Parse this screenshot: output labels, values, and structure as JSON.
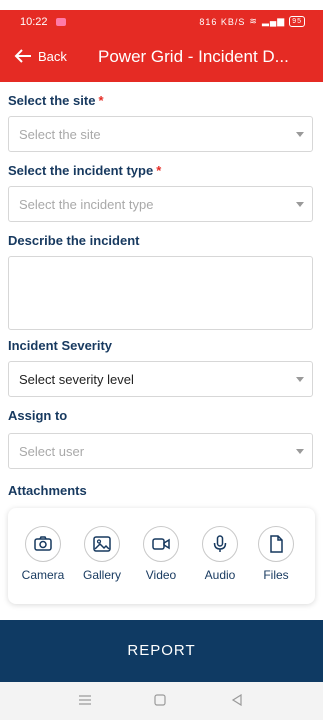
{
  "status": {
    "time": "10:22",
    "right_text": "816 KB/S",
    "battery": "95"
  },
  "appbar": {
    "back_label": "Back",
    "title": "Power Grid - Incident D..."
  },
  "form": {
    "site": {
      "label": "Select the site",
      "required_mark": "*",
      "placeholder": "Select the site"
    },
    "incident_type": {
      "label": "Select the incident type",
      "required_mark": "*",
      "placeholder": "Select the incident type"
    },
    "description": {
      "label": "Describe the incident"
    },
    "severity": {
      "label": "Incident Severity",
      "value": "Select severity level"
    },
    "assign": {
      "label": "Assign to",
      "placeholder": "Select user"
    }
  },
  "attachments": {
    "label": "Attachments",
    "items": [
      {
        "label": "Camera",
        "icon": "camera-icon"
      },
      {
        "label": "Gallery",
        "icon": "image-icon"
      },
      {
        "label": "Video",
        "icon": "video-icon"
      },
      {
        "label": "Audio",
        "icon": "microphone-icon"
      },
      {
        "label": "Files",
        "icon": "file-icon"
      }
    ]
  },
  "report_button": "REPORT",
  "colors": {
    "header": "#e52b24",
    "primary": "#0f3a63",
    "label": "#17395f"
  }
}
